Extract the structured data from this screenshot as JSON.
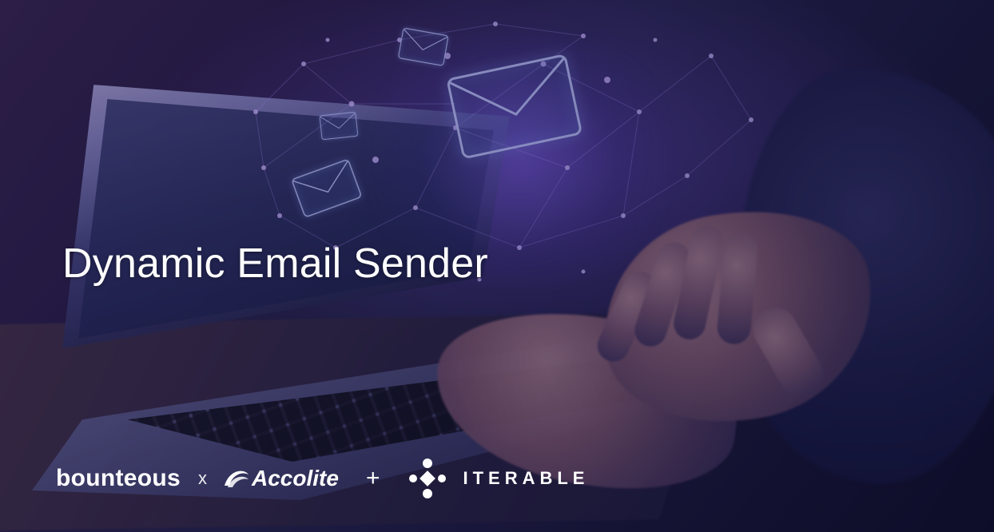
{
  "headline": "Dynamic Email Sender",
  "logos": {
    "bounteous": "bounteous",
    "separator1": "x",
    "accolite": "Accolite",
    "plus": "+",
    "iterable": "ITERABLE"
  }
}
